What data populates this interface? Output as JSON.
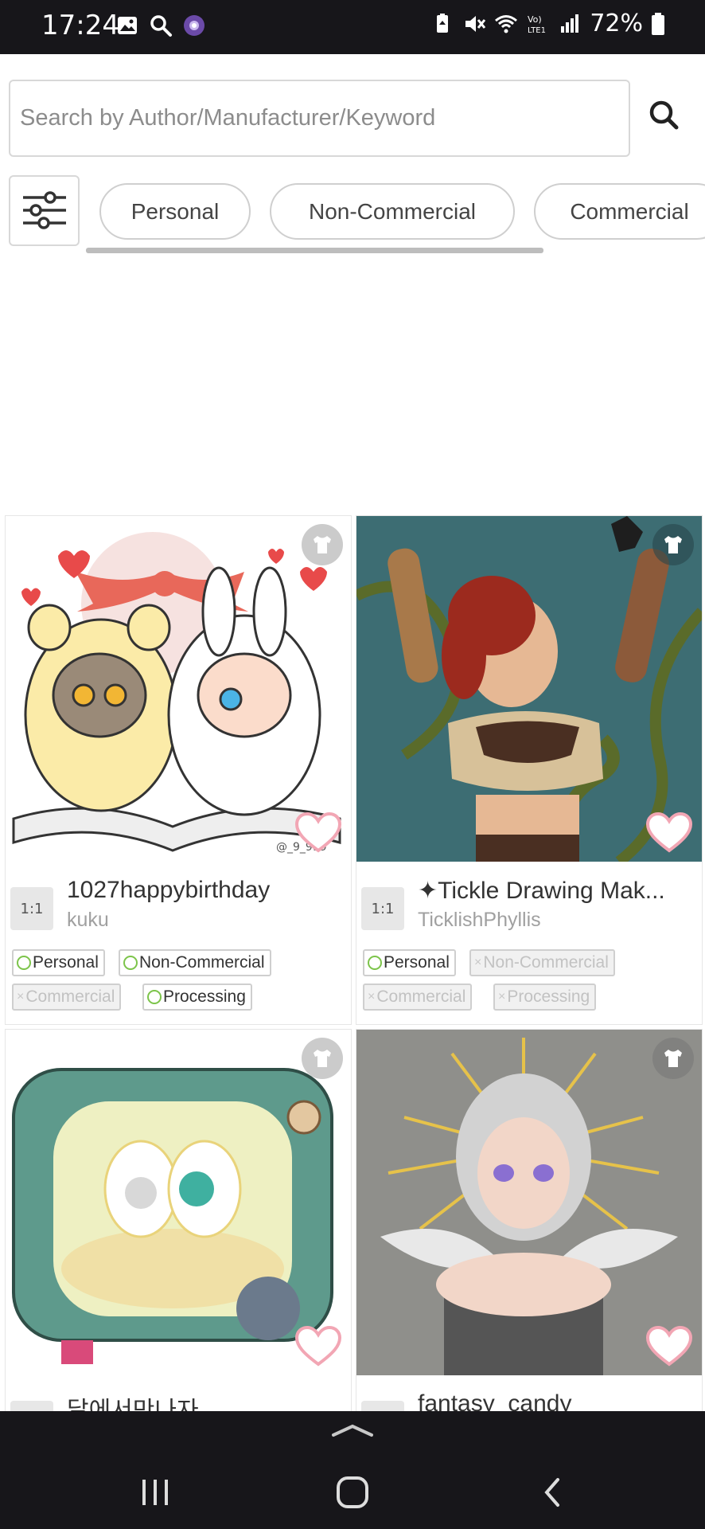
{
  "status_bar": {
    "time": "17:24",
    "battery": "72%",
    "left_icons": [
      "image-icon",
      "search-icon",
      "app-icon"
    ],
    "right_icons": [
      "battery-saver-icon",
      "mute-icon",
      "wifi-icon",
      "volte-icon",
      "signal-icon",
      "battery-icon"
    ]
  },
  "search": {
    "placeholder": "Search by Author/Manufacturer/Keyword",
    "button_icon": "search-icon"
  },
  "filters": {
    "icon": "sliders-icon",
    "chips": [
      "Personal",
      "Non-Commercial",
      "Commercial"
    ]
  },
  "cards": [
    {
      "ratio": "1:1",
      "title": "1027happybirthday",
      "author": "kuku",
      "watermark": "@_9_999",
      "tags": [
        {
          "label": "Personal",
          "on": true
        },
        {
          "label": "Non-Commercial",
          "on": true
        },
        {
          "label": "Commercial",
          "on": false
        },
        {
          "label": "Processing",
          "on": true
        }
      ]
    },
    {
      "ratio": "1:1",
      "title": "✦Tickle Drawing Mak...",
      "author": "TicklishPhyllis",
      "tags": [
        {
          "label": "Personal",
          "on": true
        },
        {
          "label": "Non-Commercial",
          "on": false
        },
        {
          "label": "Commercial",
          "on": false
        },
        {
          "label": "Processing",
          "on": false
        }
      ]
    },
    {
      "ratio": "",
      "title": "달에서만나자",
      "author": "",
      "tags": []
    },
    {
      "ratio": "",
      "title": "fantasy_candy",
      "author": "",
      "tags": []
    }
  ],
  "colors": {
    "status_bar": "#17161a",
    "tag_on_circle": "#7cc44a",
    "bunny_teal": "#5e9a8c",
    "vine_bg": "#3d6d73"
  }
}
